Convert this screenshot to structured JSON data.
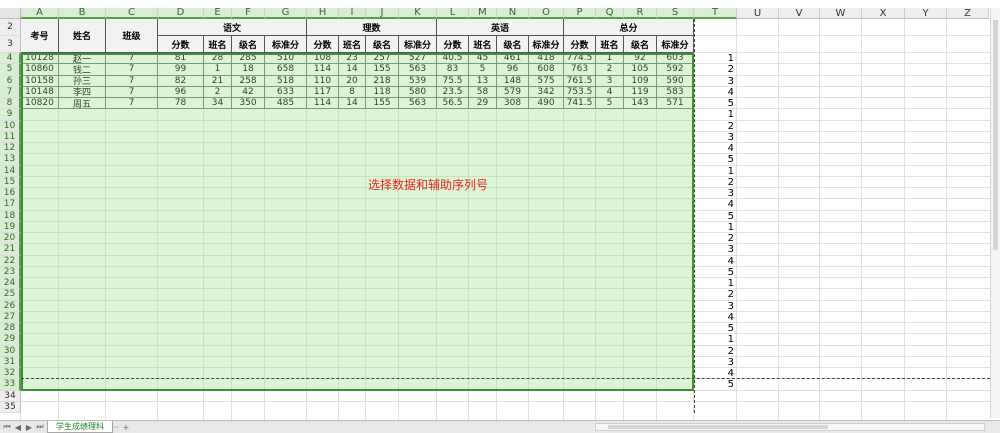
{
  "sheet": {
    "columns": [
      "A",
      "B",
      "C",
      "D",
      "E",
      "F",
      "G",
      "H",
      "I",
      "J",
      "K",
      "L",
      "M",
      "N",
      "O",
      "P",
      "Q",
      "R",
      "S",
      "T",
      "U",
      "V",
      "W",
      "X",
      "Y",
      "Z"
    ],
    "row_numbers": [
      "2",
      "3",
      "4",
      "5",
      "6",
      "7",
      "8",
      "9",
      "10",
      "11",
      "12",
      "13",
      "14",
      "15",
      "16",
      "17",
      "18",
      "19",
      "20",
      "21",
      "22",
      "23",
      "24",
      "25",
      "26",
      "27",
      "28",
      "29",
      "30",
      "31",
      "32",
      "33",
      "34",
      "35"
    ],
    "header": {
      "kaohao": "考号",
      "xingming": "姓名",
      "banji": "班级",
      "groups": [
        "语文",
        "理数",
        "英语",
        "总分"
      ],
      "sub": [
        "分数",
        "班名",
        "级名",
        "标准分"
      ]
    },
    "rows": [
      [
        "10128",
        "赵一",
        "7",
        "81",
        "28",
        "285",
        "510",
        "108",
        "23",
        "257",
        "527",
        "40.5",
        "45",
        "461",
        "418",
        "774.5",
        "1",
        "92",
        "603"
      ],
      [
        "10860",
        "钱二",
        "7",
        "99",
        "1",
        "18",
        "658",
        "114",
        "14",
        "155",
        "563",
        "83",
        "5",
        "96",
        "608",
        "763",
        "2",
        "105",
        "592"
      ],
      [
        "10158",
        "孙三",
        "7",
        "82",
        "21",
        "258",
        "518",
        "110",
        "20",
        "218",
        "539",
        "75.5",
        "13",
        "148",
        "575",
        "761.5",
        "3",
        "109",
        "590"
      ],
      [
        "10148",
        "李四",
        "7",
        "96",
        "2",
        "42",
        "633",
        "117",
        "8",
        "118",
        "580",
        "23.5",
        "58",
        "579",
        "342",
        "753.5",
        "4",
        "119",
        "583"
      ],
      [
        "10820",
        "周五",
        "7",
        "78",
        "34",
        "350",
        "485",
        "114",
        "14",
        "155",
        "563",
        "56.5",
        "29",
        "308",
        "490",
        "741.5",
        "5",
        "143",
        "571"
      ]
    ],
    "helper_sequence": [
      "1",
      "2",
      "3",
      "4",
      "5",
      "1",
      "2",
      "3",
      "4",
      "5",
      "1",
      "2",
      "3",
      "4",
      "5",
      "1",
      "2",
      "3",
      "4",
      "5",
      "1",
      "2",
      "3",
      "4",
      "5",
      "1",
      "2",
      "3",
      "4",
      "5"
    ],
    "annotation": "选择数据和辅助序列号"
  },
  "tabbar": {
    "nav": [
      "⏮",
      "◀",
      "▶",
      "⏭"
    ],
    "sheet_tab": "学生成绩理科",
    "more": "···",
    "add": "+"
  },
  "colors": {
    "selection_fill": "#d8f0cf",
    "selection_border": "#3f8f35",
    "annotation": "#e5281b",
    "tab_text": "#208030"
  }
}
